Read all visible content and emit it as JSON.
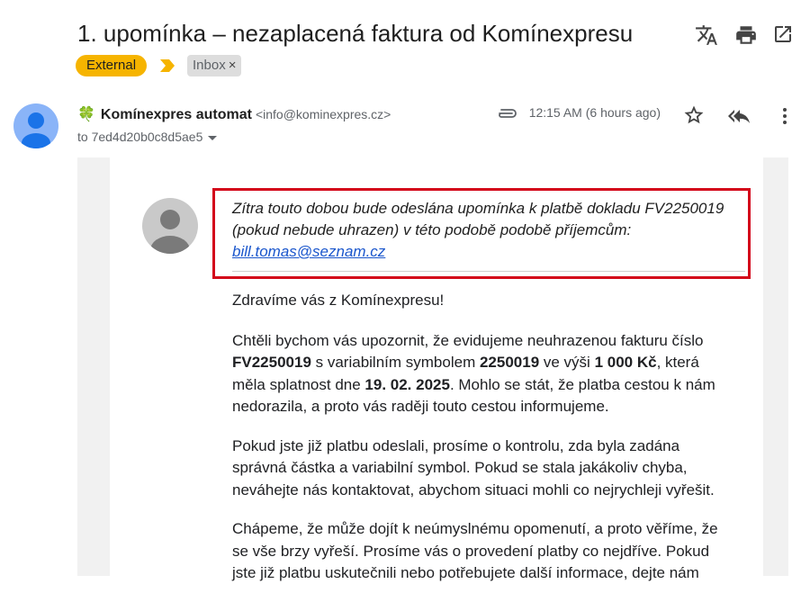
{
  "email": {
    "subject": "1. upomínka – nezaplacená faktura od Komínexpresu",
    "labels": {
      "external": "External",
      "inbox": "Inbox",
      "remove_symbol": "×"
    },
    "sender": {
      "name": "Komínexpres automat",
      "email": "<info@kominexpres.cz>",
      "recipient": "to 7ed4d20b0c8d5ae5"
    },
    "time": "12:15 AM (6 hours ago)"
  },
  "toolbar": {
    "icons": [
      "translate-icon",
      "print-icon",
      "open-in-new-window-icon"
    ]
  },
  "message_actions": {
    "icons": [
      "attachment-icon",
      "star-icon",
      "reply-all-icon",
      "more-vertical-icon"
    ]
  },
  "warning": {
    "line1": "Zítra touto dobou bude odeslána upomínka k platbě dokladu FV2250019",
    "line2": "(pokud nebude uhrazen) v této podobě podobě příjemcům:",
    "link": "bill.tomas@seznam.cz"
  },
  "body": {
    "greeting": "Zdravíme vás z Komínexpresu!",
    "p1": {
      "a": "Chtěli bychom vás upozornit, že evidujeme neuhrazenou fakturu číslo ",
      "invoice": "FV2250019",
      "b": " s variabilním symbolem ",
      "vs": "2250019",
      "c": " ve výši ",
      "amount": "1 000 Kč",
      "d": ", která měla splatnost dne ",
      "due": "19. 02. 2025",
      "e": ". Mohlo se stát, že platba cestou k nám nedorazila, a proto vás raději touto cestou informujeme."
    },
    "p2": "Pokud jste již platbu odeslali, prosíme o kontrolu, zda byla zadána správná částka a variabilní symbol. Pokud se stala jakákoliv chyba, neváhejte nás kontaktovat, abychom situaci mohli co nejrychleji vyřešit.",
    "p3": "Chápeme, že může dojít k neúmyslnému opomenutí, a proto věříme, že se vše brzy vyřeší. Prosíme vás o provedení platby co nejdříve. Pokud jste již platbu uskutečnili nebo potřebujete další informace, dejte nám"
  },
  "colors": {
    "external_label": "#f6b400",
    "warning_border": "#d3061a",
    "link": "#1a56cc",
    "avatar": "#8ab4f8"
  }
}
